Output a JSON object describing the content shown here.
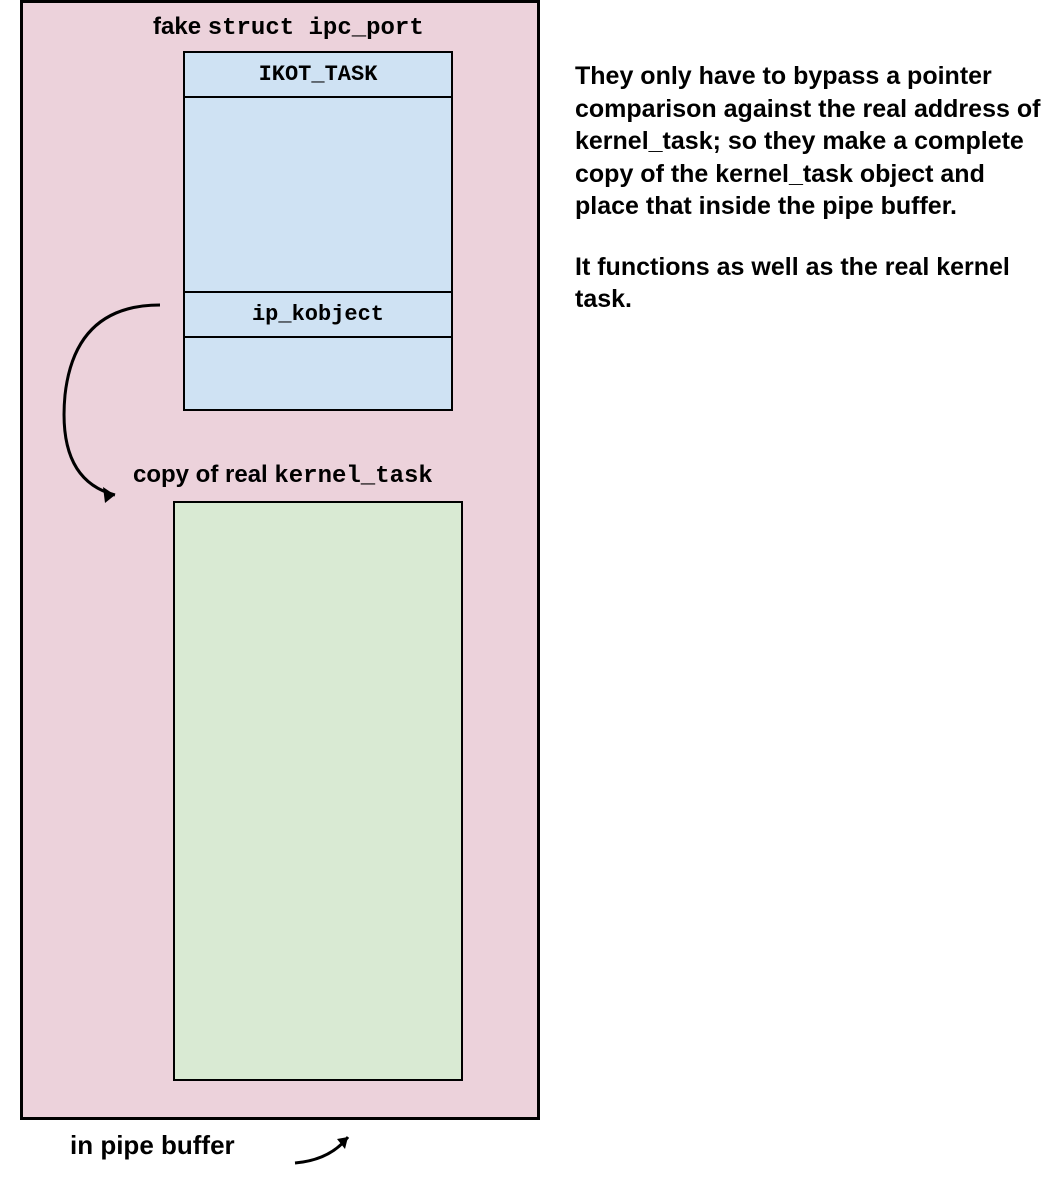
{
  "diagram": {
    "title_fake_prefix": "fake ",
    "title_fake_struct": "struct ipc_port",
    "ikot_task": "IKOT_TASK",
    "ip_kobject": "ip_kobject",
    "copy_label_prefix": "copy of real ",
    "copy_label_task": "kernel_task",
    "pipe_buffer": "in pipe buffer"
  },
  "explanation": {
    "p1": "They only have to bypass a pointer comparison against the real address of kernel_task; so they make a complete copy of the kernel_task object and place that inside the pipe buffer.",
    "p2": "It functions as well as the real kernel task."
  }
}
